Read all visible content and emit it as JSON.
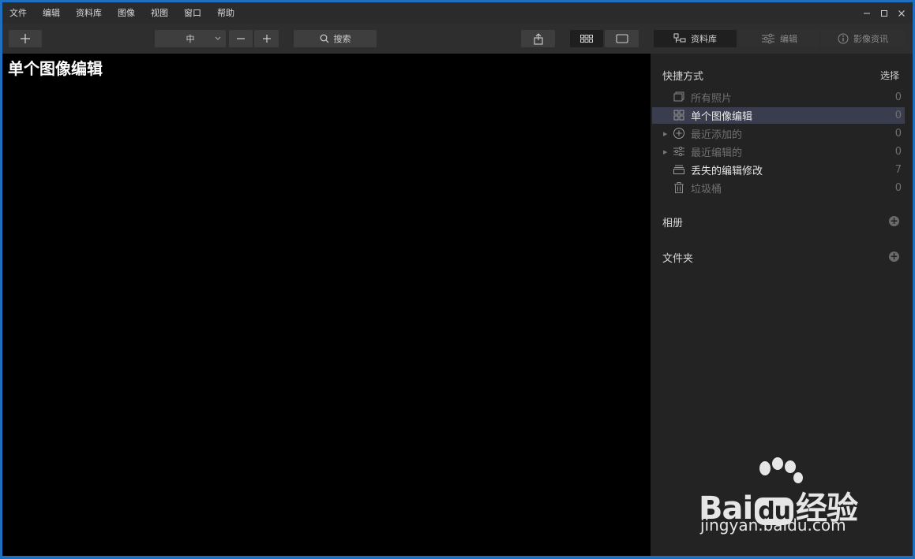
{
  "menu": [
    "文件",
    "编辑",
    "资料库",
    "图像",
    "视图",
    "窗口",
    "帮助"
  ],
  "toolbar": {
    "size_value": "中",
    "search_label": "搜索",
    "tabs": [
      {
        "label": "资料库",
        "active": true
      },
      {
        "label": "编辑",
        "active": false
      },
      {
        "label": "影像资讯",
        "active": false
      }
    ]
  },
  "main": {
    "title": "单个图像编辑"
  },
  "sidebar": {
    "shortcuts": {
      "heading": "快捷方式",
      "action": "选择",
      "items": [
        {
          "label": "所有照片",
          "count": "0",
          "state": "dim"
        },
        {
          "label": "单个图像编辑",
          "count": "0",
          "state": "selected"
        },
        {
          "label": "最近添加的",
          "count": "0",
          "state": "dim"
        },
        {
          "label": "最近编辑的",
          "count": "0",
          "state": "dim"
        },
        {
          "label": "丢失的编辑修改",
          "count": "7",
          "state": "bright"
        },
        {
          "label": "垃圾桶",
          "count": "0",
          "state": "dim"
        }
      ]
    },
    "albums": {
      "heading": "相册"
    },
    "folders": {
      "heading": "文件夹"
    }
  },
  "watermark": {
    "brand": "Bai",
    "brand2": "经验",
    "url": "jingyan.baidu.com"
  },
  "colors": {
    "selected_row": "#3a3d4e",
    "window_border": "#1f6fc0",
    "canvas": "#000000"
  }
}
